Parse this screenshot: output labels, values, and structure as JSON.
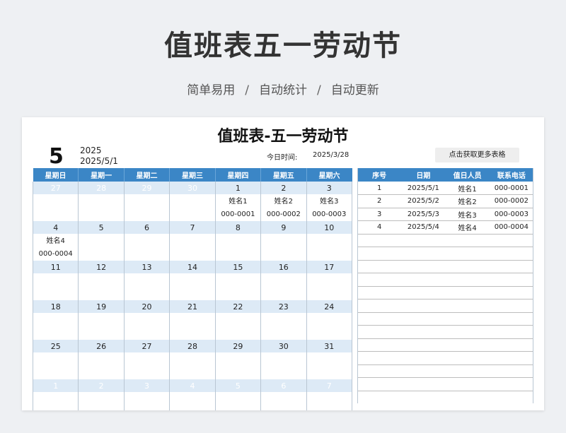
{
  "header": {
    "title": "值班表五一劳动节",
    "subtitle": [
      "简单易用",
      "自动统计",
      "自动更新"
    ],
    "separator": "/"
  },
  "sheet": {
    "title": "值班表-五一劳动节",
    "month": "5",
    "year": "2025",
    "date": "2025/5/1",
    "today_label": "今日时间:",
    "today_value": "2025/3/28",
    "more_button": "点击获取更多表格"
  },
  "calendar": {
    "weekdays": [
      "星期日",
      "星期一",
      "星期二",
      "星期三",
      "星期四",
      "星期五",
      "星期六"
    ],
    "weeks": [
      [
        {
          "day": "27",
          "other": true
        },
        {
          "day": "28",
          "other": true
        },
        {
          "day": "29",
          "other": true
        },
        {
          "day": "30",
          "other": true
        },
        {
          "day": "1",
          "name": "姓名1",
          "phone": "000-0001"
        },
        {
          "day": "2",
          "name": "姓名2",
          "phone": "000-0002"
        },
        {
          "day": "3",
          "name": "姓名3",
          "phone": "000-0003"
        }
      ],
      [
        {
          "day": "4",
          "name": "姓名4",
          "phone": "000-0004"
        },
        {
          "day": "5"
        },
        {
          "day": "6"
        },
        {
          "day": "7"
        },
        {
          "day": "8"
        },
        {
          "day": "9"
        },
        {
          "day": "10"
        }
      ],
      [
        {
          "day": "11"
        },
        {
          "day": "12"
        },
        {
          "day": "13"
        },
        {
          "day": "14"
        },
        {
          "day": "15"
        },
        {
          "day": "16"
        },
        {
          "day": "17"
        }
      ],
      [
        {
          "day": "18"
        },
        {
          "day": "19"
        },
        {
          "day": "20"
        },
        {
          "day": "21"
        },
        {
          "day": "22"
        },
        {
          "day": "23"
        },
        {
          "day": "24"
        }
      ],
      [
        {
          "day": "25"
        },
        {
          "day": "26"
        },
        {
          "day": "27"
        },
        {
          "day": "28"
        },
        {
          "day": "29"
        },
        {
          "day": "30"
        },
        {
          "day": "31"
        }
      ],
      [
        {
          "day": "1",
          "other": true
        },
        {
          "day": "2",
          "other": true
        },
        {
          "day": "3",
          "other": true
        },
        {
          "day": "4",
          "other": true
        },
        {
          "day": "5",
          "other": true
        },
        {
          "day": "6",
          "other": true
        },
        {
          "day": "7",
          "other": true
        }
      ]
    ]
  },
  "duty_list": {
    "columns": [
      "序号",
      "日期",
      "值日人员",
      "联系电话"
    ],
    "rows": [
      [
        "1",
        "2025/5/1",
        "姓名1",
        "000-0001"
      ],
      [
        "2",
        "2025/5/2",
        "姓名2",
        "000-0002"
      ],
      [
        "3",
        "2025/5/3",
        "姓名3",
        "000-0003"
      ],
      [
        "4",
        "2025/5/4",
        "姓名4",
        "000-0004"
      ]
    ],
    "empty_rows": 12
  },
  "colors": {
    "header_blue": "#3b86c6",
    "date_row": "#ddeaf6",
    "background": "#eef0f3"
  }
}
